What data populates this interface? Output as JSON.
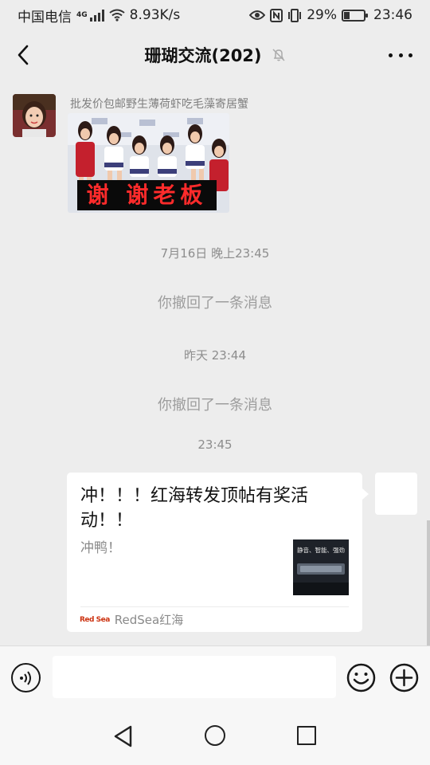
{
  "status_bar": {
    "carrier": "中国电信",
    "network_type": "4G",
    "speed": "8.93K/s",
    "battery_percent": "29%",
    "battery_level": 0.29,
    "time": "23:46",
    "icons": [
      "signal-icon",
      "wifi-icon",
      "eye-icon",
      "nfc-icon",
      "vibrate-icon",
      "battery-icon"
    ]
  },
  "nav": {
    "title": "珊瑚交流(202)",
    "icons": [
      "back-icon",
      "mute-icon",
      "more-icon"
    ]
  },
  "messages": {
    "first": {
      "sender": "批发价包邮野生薄荷虾吃毛藻寄居蟹",
      "image_caption": "谢 谢老板"
    },
    "time1": "7月16日 晚上23:45",
    "recall1": "你撤回了一条消息",
    "time2": "昨天 23:44",
    "recall2": "你撤回了一条消息",
    "time3": "23:45",
    "card": {
      "title": "冲！！！红海转发顶帖有奖活动！！",
      "description": "冲鸭！",
      "thumb_text": "静音、智能、强劲",
      "source_logo": "Red Sea",
      "source_name": "RedSea红海"
    }
  },
  "input": {
    "placeholder": "",
    "value": "",
    "icons": [
      "voice-icon",
      "emoji-icon",
      "plus-icon"
    ]
  },
  "system_nav": {
    "icons": [
      "nav-back-icon",
      "nav-home-icon",
      "nav-recent-icon"
    ]
  },
  "colors": {
    "background": "#ededed",
    "bubble": "#ffffff",
    "caption_text": "#ff2b2b"
  }
}
